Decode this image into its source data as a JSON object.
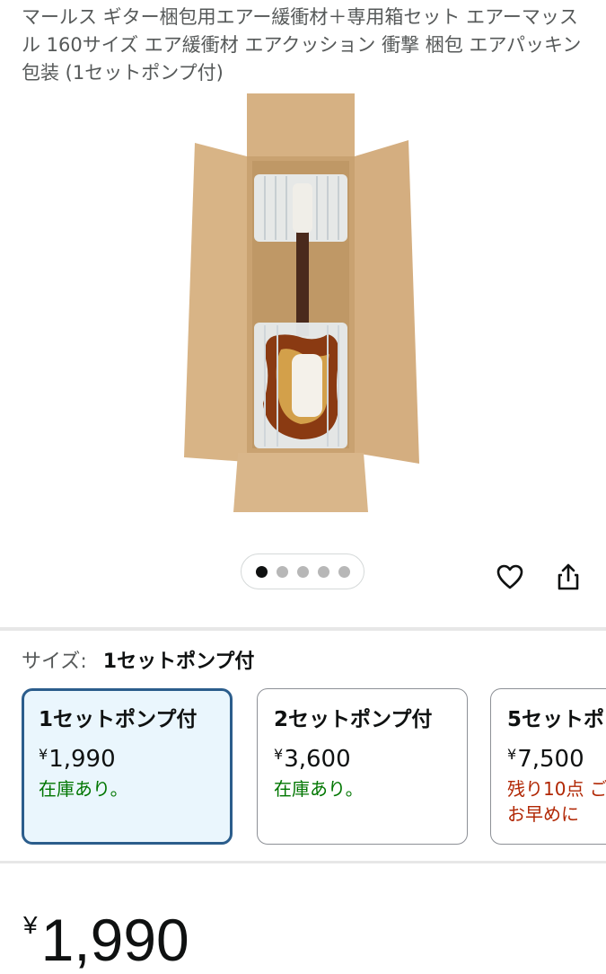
{
  "product": {
    "title": "マールス ギター梱包用エアー緩衝材＋専用箱セット エアーマッスル 160サイズ エア緩衝材 エアクッション 衝撃 梱包 エアパッキン 包装 (1セットポンプ付)",
    "image_icon": "guitar-in-box-image"
  },
  "gallery": {
    "dot_count": 5,
    "active_index": 0
  },
  "actions": {
    "heart_icon": "heart-icon",
    "share_icon": "share-icon"
  },
  "size": {
    "label": "サイズ:",
    "selected": "1セットポンプ付",
    "options": [
      {
        "name": "1セットポンプ付",
        "currency": "¥",
        "price": "1,990",
        "stock": "在庫あり。"
      },
      {
        "name": "2セットポンプ付",
        "currency": "¥",
        "price": "3,600",
        "stock": "在庫あり。"
      },
      {
        "name": "5セットポ",
        "currency": "¥",
        "price": "7,500",
        "stock": "残り10点 ご",
        "stock2": "お早めに"
      }
    ]
  },
  "price": {
    "currency": "¥",
    "amount": "1,990"
  },
  "colors": {
    "accent_border": "#2b5d8c",
    "selected_bg": "#eaf6fd",
    "in_stock": "#007600",
    "low_stock": "#b12704"
  }
}
